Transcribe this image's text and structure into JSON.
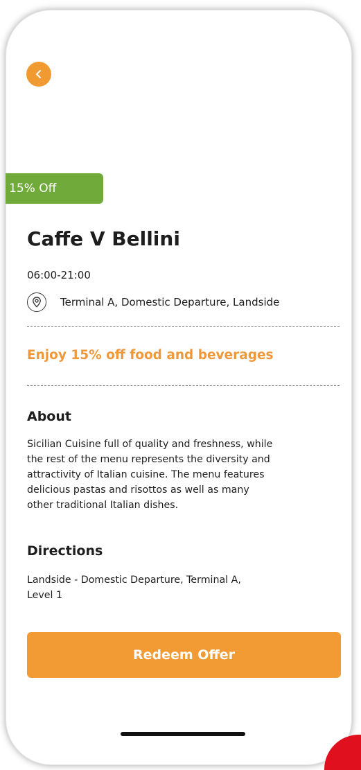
{
  "colors": {
    "accent_orange": "#f29a33",
    "offer_text_orange": "#f09838",
    "badge_green": "#6faa3a",
    "text_dark": "#1d1d1d",
    "red_corner": "#e0101e"
  },
  "header": {
    "back_icon": "chevron-left-icon"
  },
  "badge": {
    "label": "15% Off"
  },
  "place": {
    "name": "Caffe V Bellini",
    "hours": "06:00-21:00",
    "location_icon": "location-pin-icon",
    "location": "Terminal A, Domestic Departure, Landside"
  },
  "offer": {
    "headline": "Enjoy 15% off food and beverages"
  },
  "about": {
    "heading": "About",
    "text": "Sicilian Cuisine full of quality and freshness, while\nthe rest of the menu represents the diversity and\nattractivity of Italian cuisine. The menu features\ndelicious pastas and risottos as well as many\nother traditional Italian dishes."
  },
  "directions": {
    "heading": "Directions",
    "text": "Landside - Domestic Departure, Terminal A,\nLevel 1"
  },
  "actions": {
    "redeem_label": "Redeem Offer"
  }
}
